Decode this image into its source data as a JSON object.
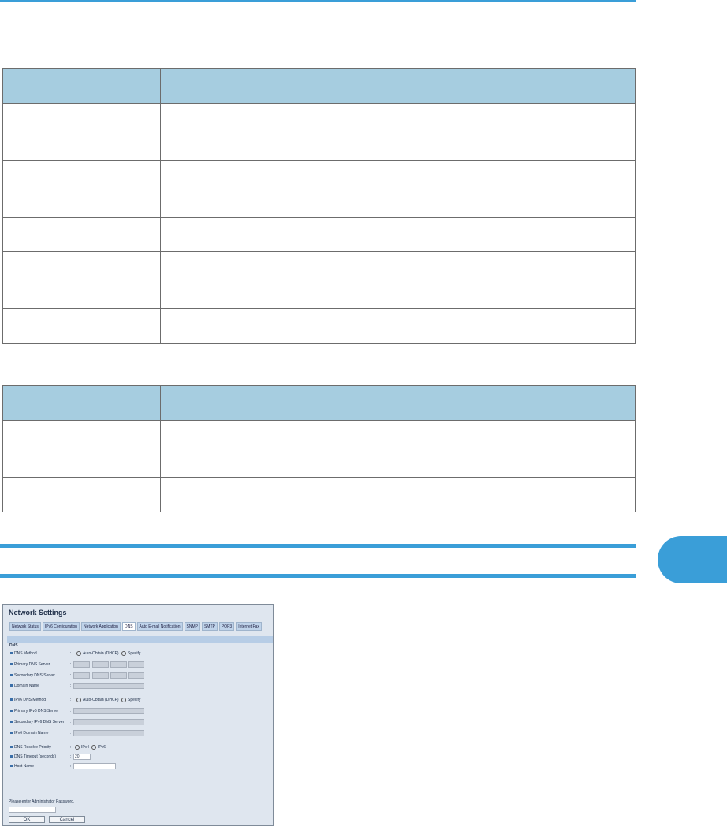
{
  "screenshot": {
    "title": "Network Settings",
    "tabs": [
      "Network Status",
      "IPv6 Configuration",
      "Network Application",
      "DNS",
      "Auto E-mail Notification",
      "SNMP",
      "SMTP",
      "POP3",
      "Internet Fax"
    ],
    "active_tab": "DNS",
    "section": "DNS",
    "rows": {
      "dns_method": "DNS Method",
      "primary_dns": "Primary DNS Server",
      "secondary_dns": "Secondary DNS Server",
      "domain_name": "Domain Name",
      "ipv6_dns_method": "IPv6 DNS Method",
      "primary_ipv6_dns": "Primary IPv6 DNS Server",
      "secondary_ipv6_dns": "Secondary IPv6 DNS Server",
      "ipv6_domain_name": "IPv6 Domain Name",
      "resolve_priority": "DNS Resolve Priority",
      "timeout": "DNS Timeout (seconds)",
      "host_name": "Host Name"
    },
    "auto_obtain": "Auto-Obtain (DHCP)",
    "specify": "Specify",
    "ipv4": "IPv4",
    "ipv6": "IPv6",
    "timeout_value": "20",
    "password_prompt": "Please enter Administrator Password.",
    "ok": "OK",
    "cancel": "Cancel"
  }
}
